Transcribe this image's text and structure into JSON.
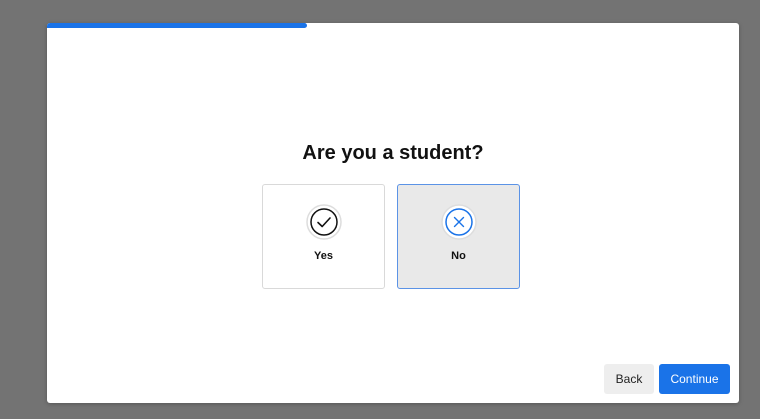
{
  "progress": {
    "fraction": 0.375
  },
  "question": {
    "title": "Are you a student?"
  },
  "options": [
    {
      "label": "Yes",
      "icon": "check-circle-icon",
      "selected": false
    },
    {
      "label": "No",
      "icon": "x-circle-icon",
      "selected": true
    }
  ],
  "footer": {
    "back_label": "Back",
    "continue_label": "Continue"
  },
  "colors": {
    "accent": "#1a73e8",
    "backdrop": "#737373",
    "selected_bg": "#e9e9e9"
  }
}
